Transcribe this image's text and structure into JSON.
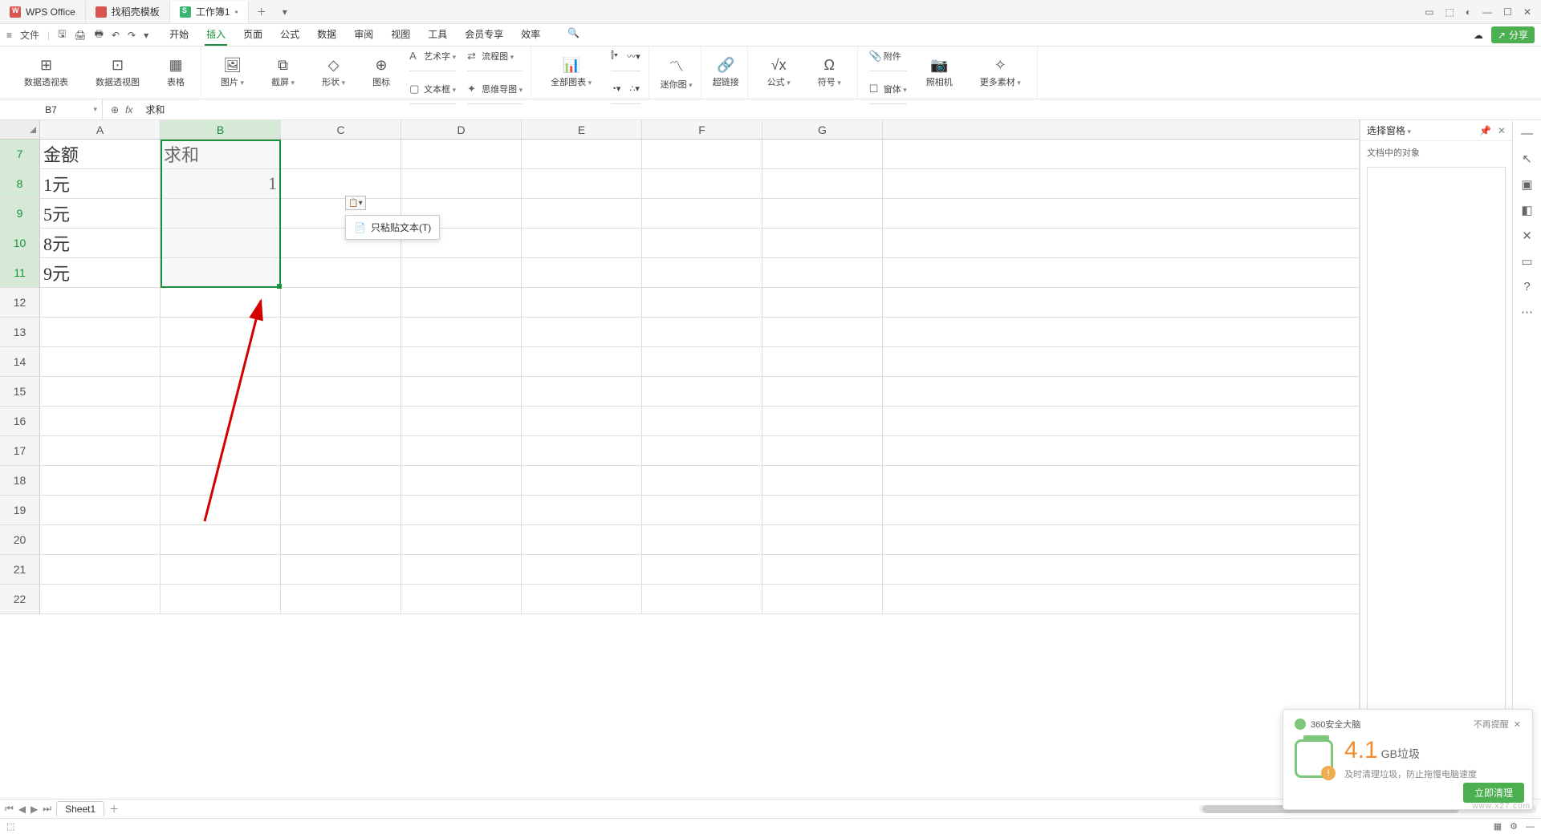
{
  "title_bar": {
    "tabs": [
      {
        "label": "WPS Office"
      },
      {
        "label": "找稻壳模板"
      },
      {
        "label": "工作簿1"
      }
    ]
  },
  "menu": {
    "file": "文件",
    "tabs": [
      "开始",
      "插入",
      "页面",
      "公式",
      "数据",
      "审阅",
      "视图",
      "工具",
      "会员专享",
      "效率"
    ],
    "active_index": 1,
    "share": "分享"
  },
  "ribbon": {
    "group1": {
      "pivot_table": "数据透视表",
      "pivot_chart": "数据透视图",
      "table": "表格"
    },
    "group2": {
      "picture": "图片",
      "screenshot": "截屏",
      "shapes": "形状",
      "icons": "图标"
    },
    "group2b": {
      "wordart": "艺术字",
      "textbox": "文本框",
      "flowchart": "流程图",
      "mindmap": "思维导图"
    },
    "group3": {
      "all_charts": "全部图表"
    },
    "group4": {
      "sparkline": "迷你图"
    },
    "group5": {
      "hyperlink": "超链接"
    },
    "group6": {
      "formula": "公式",
      "symbol": "符号"
    },
    "group7": {
      "attachment": "附件",
      "form_parts": "窗体",
      "camera": "照相机",
      "more": "更多素材"
    }
  },
  "formula_bar": {
    "name_box": "B7",
    "content": "求和"
  },
  "columns": [
    "A",
    "B",
    "C",
    "D",
    "E",
    "F",
    "G"
  ],
  "row_start": 7,
  "row_end": 22,
  "cells": {
    "A7": "金额",
    "B7": "求和",
    "A8": "1元",
    "B8": "1",
    "A9": "5元",
    "A10": "8元",
    "A11": "9元"
  },
  "paste_menu": "只粘贴文本(T)",
  "right_panel": {
    "title": "选择窗格",
    "subtitle": "文档中的对象"
  },
  "sheet_tab": "Sheet1",
  "popup": {
    "title": "360安全大脑",
    "no_remind": "不再提醒",
    "value": "4.1",
    "unit": "GB垃圾",
    "tip": "及时清理垃圾，防止拖慢电脑速度",
    "button": "立即清理",
    "watermark": "www.x27.com"
  }
}
